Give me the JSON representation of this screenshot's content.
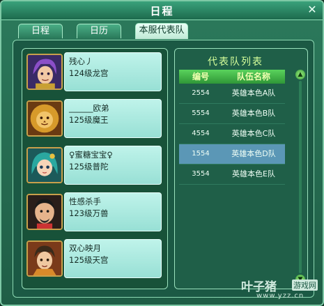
{
  "window": {
    "title": "日程"
  },
  "tabs": [
    {
      "label": "日程",
      "active": false
    },
    {
      "label": "日历",
      "active": false
    },
    {
      "label": "本服代表队",
      "active": true
    }
  ],
  "members": [
    {
      "name": "残心丿",
      "level": "124级龙宫",
      "avatar_icon": "purple-haired-character-icon"
    },
    {
      "name": "______欧弟",
      "level": "125级魔王",
      "avatar_icon": "lion-demon-character-icon"
    },
    {
      "name": "♀蜜糖宝宝♀",
      "level": "125级普陀",
      "avatar_icon": "teal-haired-girl-character-icon"
    },
    {
      "name": "性感杀手",
      "level": "123级万兽",
      "avatar_icon": "bald-warrior-character-icon"
    },
    {
      "name": "双心映月",
      "level": "125级天宫",
      "avatar_icon": "young-warrior-character-icon"
    }
  ],
  "team_list": {
    "title": "代表队列表",
    "headers": {
      "id": "编号",
      "name": "队伍名称"
    },
    "rows": [
      {
        "id": "2554",
        "name": "英雄本色A队",
        "selected": false
      },
      {
        "id": "5554",
        "name": "英雄本色B队",
        "selected": false
      },
      {
        "id": "4554",
        "name": "英雄本色C队",
        "selected": false
      },
      {
        "id": "1554",
        "name": "英雄本色D队",
        "selected": true
      },
      {
        "id": "3554",
        "name": "英雄本色E队",
        "selected": false
      }
    ]
  },
  "watermark": {
    "brand": "叶子猪",
    "tag": "游戏网",
    "url": "www.yzz.cn"
  },
  "colors": {
    "selected_row": "#5b97b6",
    "header_green": "#3fb445",
    "card_bg": "#a8e8dd"
  }
}
